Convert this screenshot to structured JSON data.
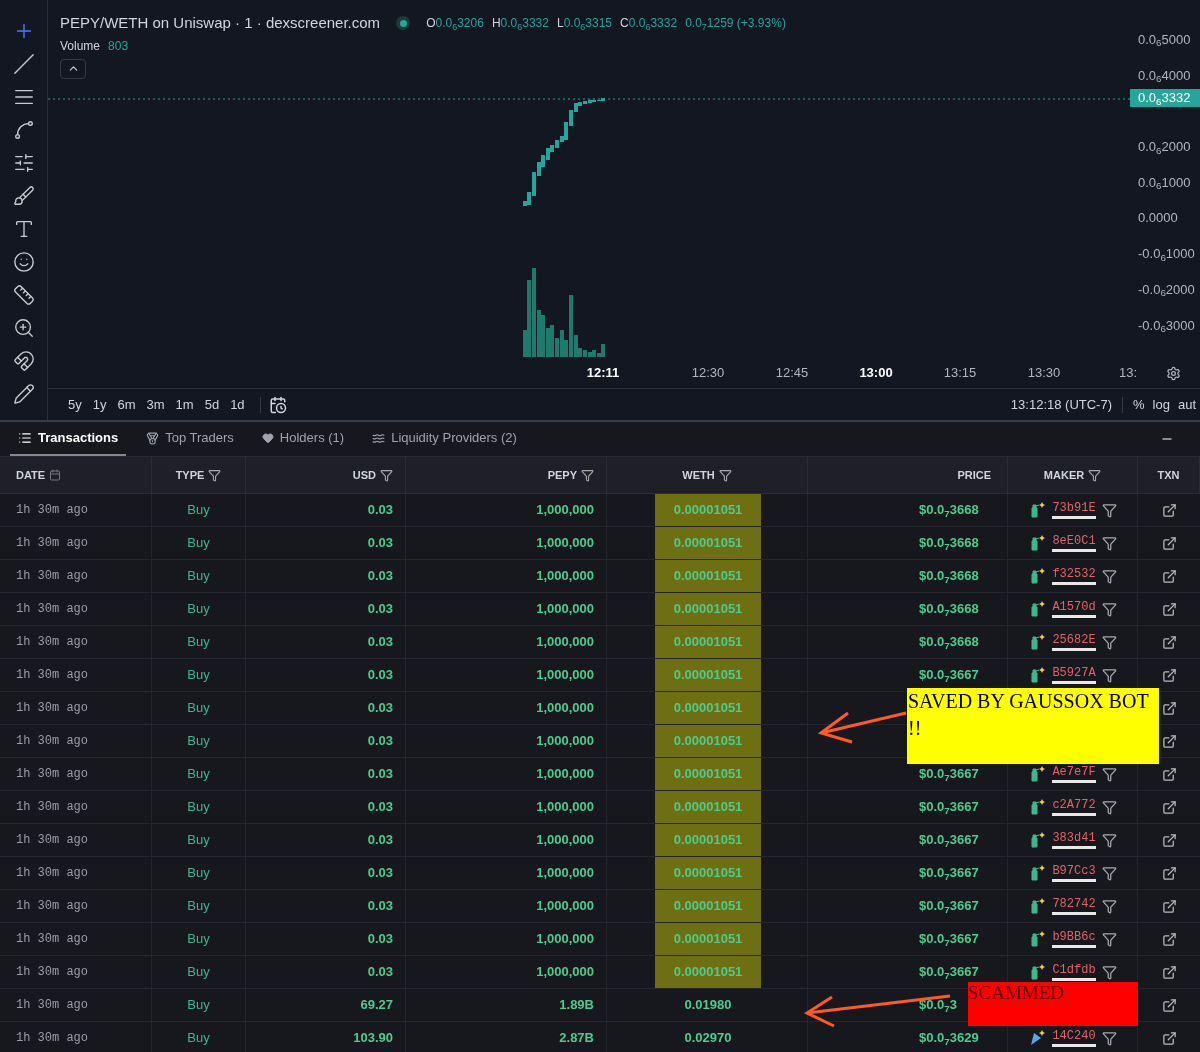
{
  "chart": {
    "title": "PEPY/WETH on Uniswap · 1 · dexscreener.com",
    "live": true,
    "ohlc": [
      {
        "label": "O",
        "value": "0.0$_{6}$3206"
      },
      {
        "label": "H",
        "value": "0.0$_{6}$3332"
      },
      {
        "label": "L",
        "value": "0.0$_{6}$3315"
      },
      {
        "label": "C",
        "value": "0.0$_{6}$3332"
      }
    ],
    "change": "0.0$_{7}$1259 (+3.93%)",
    "volume_label": "Volume",
    "volume": "803",
    "price_ticks_above": [
      "0.0$_{6}$5000",
      "0.0$_{6}$4000"
    ],
    "current_price": "0.0$_{6}$3332",
    "price_ticks_below": [
      "0.0$_{6}$2000",
      "0.0$_{6}$1000",
      "0.0000",
      "-0.0$_{6}$1000",
      "-0.0$_{6}$2000",
      "-0.0$_{6}$3000"
    ],
    "time_ticks": [
      {
        "label": "12:11",
        "bold": true
      },
      {
        "label": "12:30",
        "bold": false
      },
      {
        "label": "12:45",
        "bold": false
      },
      {
        "label": "13:00",
        "bold": true
      },
      {
        "label": "13:15",
        "bold": false
      },
      {
        "label": "13:30",
        "bold": false
      },
      {
        "label": "13:",
        "bold": false
      }
    ],
    "ranges": [
      "5y",
      "1y",
      "6m",
      "3m",
      "1m",
      "5d",
      "1d"
    ],
    "clock": "13:12:18 (UTC-7)",
    "scale_options": [
      "%",
      "log",
      "aut"
    ]
  },
  "tabs": [
    {
      "label": "Transactions",
      "selected": true
    },
    {
      "label": "Top Traders",
      "selected": false
    },
    {
      "label": "Holders (1)",
      "selected": false
    },
    {
      "label": "Liquidity Providers (2)",
      "selected": false
    }
  ],
  "table": {
    "columns": [
      {
        "label": "DATE",
        "kind": "date"
      },
      {
        "label": "TYPE",
        "kind": "filterable"
      },
      {
        "label": "USD",
        "kind": "filterable"
      },
      {
        "label": "PEPY",
        "kind": "filterable"
      },
      {
        "label": "WETH",
        "kind": "filterable"
      },
      {
        "label": "PRICE",
        "kind": "plain"
      },
      {
        "label": "MAKER",
        "kind": "filterable"
      },
      {
        "label": "TXN",
        "kind": "plain"
      }
    ],
    "rows": [
      {
        "date": "1h 30m ago",
        "type": "Buy",
        "usd": "0.03",
        "pepy": "1,000,000",
        "weth": "0.00001051",
        "highlighted": true,
        "price": "$0.0$_{7}$3668",
        "maker": {
          "address": "73b91E",
          "kind": "bottle"
        }
      },
      {
        "date": "1h 30m ago",
        "type": "Buy",
        "usd": "0.03",
        "pepy": "1,000,000",
        "weth": "0.00001051",
        "highlighted": true,
        "price": "$0.0$_{7}$3668",
        "maker": {
          "address": "8eE0C1",
          "kind": "bottle"
        }
      },
      {
        "date": "1h 30m ago",
        "type": "Buy",
        "usd": "0.03",
        "pepy": "1,000,000",
        "weth": "0.00001051",
        "highlighted": true,
        "price": "$0.0$_{7}$3668",
        "maker": {
          "address": "f32532",
          "kind": "bottle"
        }
      },
      {
        "date": "1h 30m ago",
        "type": "Buy",
        "usd": "0.03",
        "pepy": "1,000,000",
        "weth": "0.00001051",
        "highlighted": true,
        "price": "$0.0$_{7}$3668",
        "maker": {
          "address": "A1570d",
          "kind": "bottle"
        }
      },
      {
        "date": "1h 30m ago",
        "type": "Buy",
        "usd": "0.03",
        "pepy": "1,000,000",
        "weth": "0.00001051",
        "highlighted": true,
        "price": "$0.0$_{7}$3668",
        "maker": {
          "address": "25682E",
          "kind": "bottle"
        }
      },
      {
        "date": "1h 30m ago",
        "type": "Buy",
        "usd": "0.03",
        "pepy": "1,000,000",
        "weth": "0.00001051",
        "highlighted": true,
        "price": "$0.0$_{7}$3667",
        "maker": {
          "address": "B5927A",
          "kind": "bottle"
        }
      },
      {
        "date": "1h 30m ago",
        "type": "Buy",
        "usd": "0.03",
        "pepy": "1,000,000",
        "weth": "0.00001051",
        "highlighted": true
      },
      {
        "date": "1h 30m ago",
        "type": "Buy",
        "usd": "0.03",
        "pepy": "1,000,000",
        "weth": "0.00001051",
        "highlighted": true
      },
      {
        "date": "1h 30m ago",
        "type": "Buy",
        "usd": "0.03",
        "pepy": "1,000,000",
        "weth": "0.00001051",
        "highlighted": true,
        "price": "$0.0$_{7}$3667",
        "maker": {
          "address": "Ae7e7F",
          "kind": "bottle"
        }
      },
      {
        "date": "1h 30m ago",
        "type": "Buy",
        "usd": "0.03",
        "pepy": "1,000,000",
        "weth": "0.00001051",
        "highlighted": true,
        "price": "$0.0$_{7}$3667",
        "maker": {
          "address": "c2A772",
          "kind": "bottle"
        }
      },
      {
        "date": "1h 30m ago",
        "type": "Buy",
        "usd": "0.03",
        "pepy": "1,000,000",
        "weth": "0.00001051",
        "highlighted": true,
        "price": "$0.0$_{7}$3667",
        "maker": {
          "address": "383d41",
          "kind": "bottle"
        }
      },
      {
        "date": "1h 30m ago",
        "type": "Buy",
        "usd": "0.03",
        "pepy": "1,000,000",
        "weth": "0.00001051",
        "highlighted": true,
        "price": "$0.0$_{7}$3667",
        "maker": {
          "address": "B97Cc3",
          "kind": "bottle"
        }
      },
      {
        "date": "1h 30m ago",
        "type": "Buy",
        "usd": "0.03",
        "pepy": "1,000,000",
        "weth": "0.00001051",
        "highlighted": true,
        "price": "$0.0$_{7}$3667",
        "maker": {
          "address": "782742",
          "kind": "bottle"
        }
      },
      {
        "date": "1h 30m ago",
        "type": "Buy",
        "usd": "0.03",
        "pepy": "1,000,000",
        "weth": "0.00001051",
        "highlighted": true,
        "price": "$0.0$_{7}$3667",
        "maker": {
          "address": "b9BB6c",
          "kind": "bottle"
        }
      },
      {
        "date": "1h 30m ago",
        "type": "Buy",
        "usd": "0.03",
        "pepy": "1,000,000",
        "weth": "0.00001051",
        "highlighted": true,
        "price": "$0.0$_{7}$3667",
        "maker": {
          "address": "C1dfdb",
          "kind": "bottle"
        }
      },
      {
        "date": "1h 30m ago",
        "type": "Buy",
        "usd": "69.27",
        "pepy": "1.89B",
        "weth": "0.01980",
        "highlighted": false,
        "price": "$0.0$_{7}$3"
      },
      {
        "date": "1h 30m ago",
        "type": "Buy",
        "usd": "103.90",
        "pepy": "2.87B",
        "weth": "0.02970",
        "highlighted": false,
        "price": "$0.0$_{7}$3629",
        "maker": {
          "address": "14C240",
          "kind": "flag"
        }
      }
    ]
  },
  "annotations": [
    {
      "text": "SAVED BY GAUSSOX BOT !!",
      "color": "#ffff00",
      "kind": "saved"
    },
    {
      "text": "SCAMMED",
      "color": "#ff0000",
      "kind": "scammed"
    }
  ]
}
